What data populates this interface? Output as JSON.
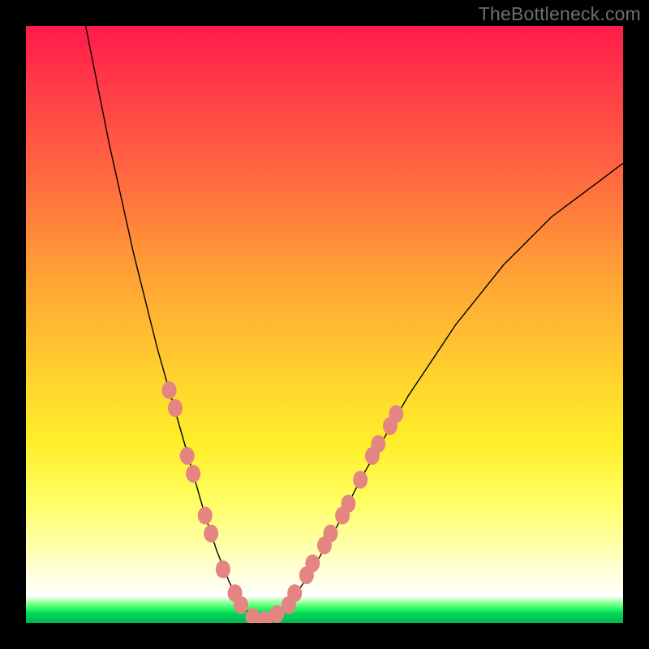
{
  "watermark": "TheBottleneck.com",
  "colors": {
    "page_bg": "#000000",
    "curve": "#000000",
    "dot": "#e58582",
    "gradient_top": "#ff1a4a",
    "gradient_bottom": "#00b84d"
  },
  "chart_data": {
    "type": "line",
    "title": "",
    "xlabel": "",
    "ylabel": "",
    "xlim": [
      0,
      100
    ],
    "ylim": [
      0,
      100
    ],
    "grid": false,
    "legend": false,
    "series": [
      {
        "name": "curve",
        "x": [
          10,
          12,
          14,
          16,
          18,
          20,
          22,
          24,
          26,
          28,
          30,
          32,
          34,
          36,
          38,
          40,
          44,
          48,
          52,
          56,
          60,
          64,
          68,
          72,
          76,
          80,
          84,
          88,
          92,
          96,
          100
        ],
        "y": [
          100,
          90,
          80,
          71,
          62,
          54,
          46,
          39,
          32,
          25,
          18,
          12,
          7,
          3,
          1,
          0.5,
          3,
          9,
          16,
          24,
          31,
          38,
          44,
          50,
          55,
          60,
          64,
          68,
          71,
          74,
          77
        ]
      }
    ],
    "dots": {
      "name": "markers",
      "points": [
        {
          "x": 24,
          "y": 39
        },
        {
          "x": 25,
          "y": 36
        },
        {
          "x": 27,
          "y": 28
        },
        {
          "x": 28,
          "y": 25
        },
        {
          "x": 30,
          "y": 18
        },
        {
          "x": 31,
          "y": 15
        },
        {
          "x": 33,
          "y": 9
        },
        {
          "x": 35,
          "y": 5
        },
        {
          "x": 36,
          "y": 3
        },
        {
          "x": 38,
          "y": 1
        },
        {
          "x": 40,
          "y": 0.5
        },
        {
          "x": 42,
          "y": 1.5
        },
        {
          "x": 44,
          "y": 3
        },
        {
          "x": 45,
          "y": 5
        },
        {
          "x": 47,
          "y": 8
        },
        {
          "x": 48,
          "y": 10
        },
        {
          "x": 50,
          "y": 13
        },
        {
          "x": 51,
          "y": 15
        },
        {
          "x": 53,
          "y": 18
        },
        {
          "x": 54,
          "y": 20
        },
        {
          "x": 56,
          "y": 24
        },
        {
          "x": 58,
          "y": 28
        },
        {
          "x": 59,
          "y": 30
        },
        {
          "x": 61,
          "y": 33
        },
        {
          "x": 62,
          "y": 35
        }
      ]
    }
  }
}
